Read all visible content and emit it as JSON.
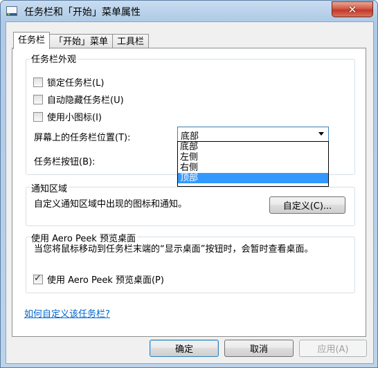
{
  "window": {
    "title": "任务栏和「开始」菜单属性",
    "close_glyph": "✕"
  },
  "tabs": [
    {
      "label": "任务栏",
      "active": true
    },
    {
      "label": "「开始」菜单",
      "active": false
    },
    {
      "label": "工具栏",
      "active": false
    }
  ],
  "appearance": {
    "title": "任务栏外观",
    "lock": {
      "label": "锁定任务栏(L)",
      "checked": false
    },
    "autohide": {
      "label": "自动隐藏任务栏(U)",
      "checked": false
    },
    "small_icons": {
      "label": "使用小图标(I)",
      "checked": false
    },
    "position_label": "屏幕上的任务栏位置(T):",
    "position_value": "底部",
    "position_options": [
      "底部",
      "左侧",
      "右侧",
      "顶部"
    ],
    "position_highlighted": "顶部",
    "buttons_label": "任务栏按钮(B):"
  },
  "notification": {
    "title": "通知区域",
    "description": "自定义通知区域中出现的图标和通知。",
    "customize_button": "自定义(C)..."
  },
  "aero_peek": {
    "title": "使用 Aero Peek 预览桌面",
    "description": "当您将鼠标移动到任务栏末端的“显示桌面”按钮时，会暂时查看桌面。",
    "checkbox": {
      "label": "使用 Aero Peek 预览桌面(P)",
      "checked": true
    }
  },
  "help_link": "如何自定义该任务栏?",
  "footer": {
    "ok": "确定",
    "cancel": "取消",
    "apply": "应用(A)"
  }
}
